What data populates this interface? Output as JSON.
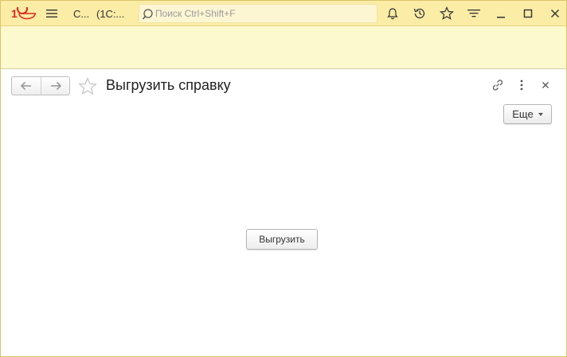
{
  "app": {
    "section_label": "С...",
    "window_title": "(1С:...",
    "brand_color": "#e0251b",
    "logo_icon": "1c-logo-icon"
  },
  "search": {
    "placeholder": "Поиск Ctrl+Shift+F"
  },
  "titlebar_icons": [
    "menu-icon",
    "search-icon",
    "bell-icon",
    "history-icon",
    "star-icon",
    "filter-icon",
    "minimize-icon",
    "maximize-icon",
    "close-icon"
  ],
  "form": {
    "title": "Выгрузить справку",
    "more_label": "Еще",
    "export_label": "Выгрузить"
  },
  "colors": {
    "titlebar_bg": "#fbeca6",
    "panel_bg": "#fdf9cf",
    "frame_border": "#d9c36c"
  }
}
